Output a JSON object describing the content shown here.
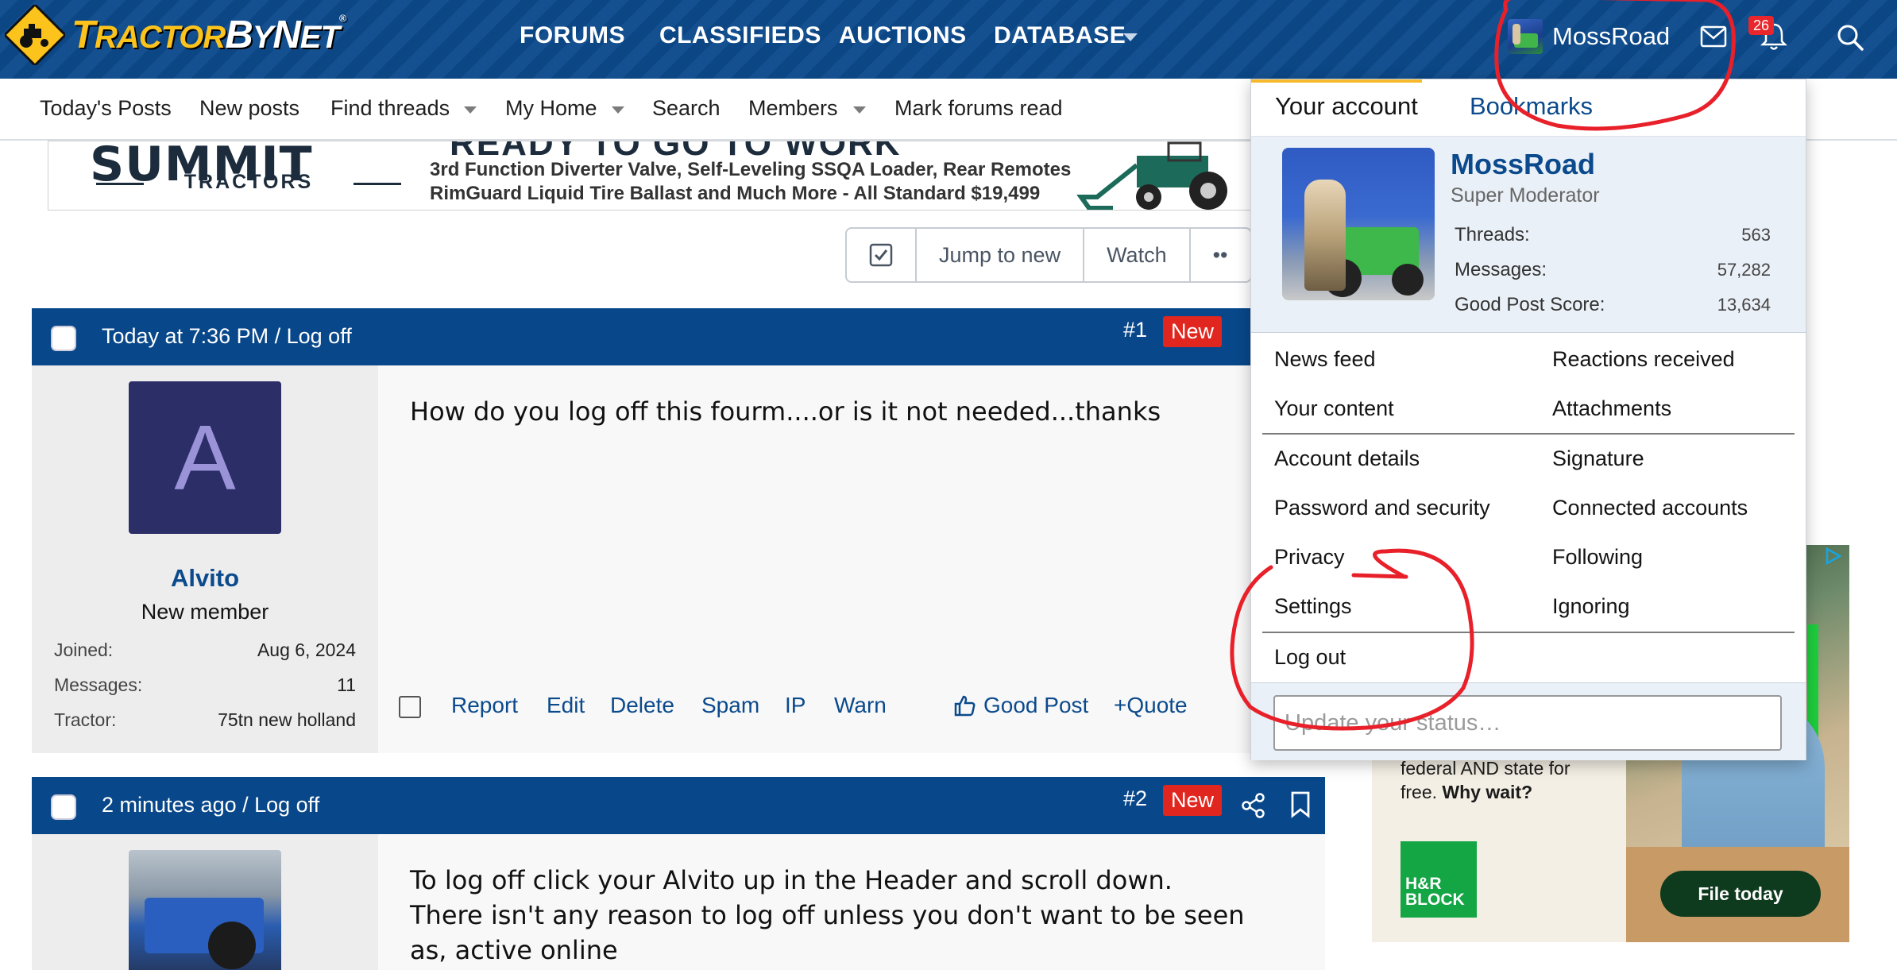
{
  "header": {
    "logo_text": "TractorByNet",
    "nav": [
      "FORUMS",
      "CLASSIFIEDS",
      "AUCTIONS",
      "DATABASE"
    ],
    "username": "MossRoad",
    "alerts_count": "26"
  },
  "subnav": {
    "items": [
      "Today's Posts",
      "New posts",
      "Find threads",
      "My Home",
      "Search",
      "Members",
      "Mark forums read"
    ]
  },
  "ad_banner": {
    "brand": "SUMMIT",
    "brand_sub": "TRACTORS",
    "headline_partial": "READY TO GO TO WORK",
    "line1": "3rd Function Diverter Valve, Self-Leveling SSQA Loader, Rear Remotes",
    "line2": "RimGuard Liquid Tire Ballast and Much More - All Standard $19,499"
  },
  "thread_buttons": {
    "jump": "Jump to new",
    "watch": "Watch",
    "more": "••"
  },
  "posts": [
    {
      "meta": "Today at 7:36 PM / Log off",
      "number": "#1",
      "new_label": "New",
      "avatar_letter": "A",
      "username": "Alvito",
      "user_title": "New member",
      "stats": [
        {
          "label": "Joined:",
          "value": "Aug 6, 2024"
        },
        {
          "label": "Messages:",
          "value": "11"
        },
        {
          "label": "Tractor:",
          "value": "75tn new holland"
        }
      ],
      "message": "How do you log off this fourm....or is it not needed...thanks",
      "actions": [
        "Report",
        "Edit",
        "Delete",
        "Spam",
        "IP",
        "Warn",
        "Good Post",
        "+Quote"
      ]
    },
    {
      "meta": "2 minutes ago / Log off",
      "number": "#2",
      "new_label": "New",
      "message_lines": [
        "To log off click your Alvito up in the Header and scroll down.",
        "There isn't any reason to log off unless you don't want to be seen",
        "as, active online"
      ]
    }
  ],
  "account_menu": {
    "tabs": [
      "Your account",
      "Bookmarks"
    ],
    "profile": {
      "name": "MossRoad",
      "role": "Super Moderator",
      "stats": [
        {
          "label": "Threads:",
          "value": "563"
        },
        {
          "label": "Messages:",
          "value": "57,282"
        },
        {
          "label": "Good Post Score:",
          "value": "13,634"
        }
      ]
    },
    "links_left": [
      "News feed",
      "Your content",
      "Account details",
      "Password and security",
      "Privacy",
      "Settings",
      "Log out"
    ],
    "links_right": [
      "Reactions received",
      "Attachments",
      "Signature",
      "Connected accounts",
      "Following",
      "Ignoring"
    ],
    "status_placeholder": "Update your status…"
  },
  "side_ad": {
    "text_line1": "federal AND state for",
    "text_line2_plain": "free. ",
    "text_line2_bold": "Why wait?",
    "logo_text": "H&R BLOCK",
    "button": "File today"
  },
  "colors": {
    "brand_blue": "#0c4a8c",
    "logo_yellow": "#fcc31d",
    "new_badge_red": "#e0261f",
    "annotation_red": "#e8202a"
  }
}
